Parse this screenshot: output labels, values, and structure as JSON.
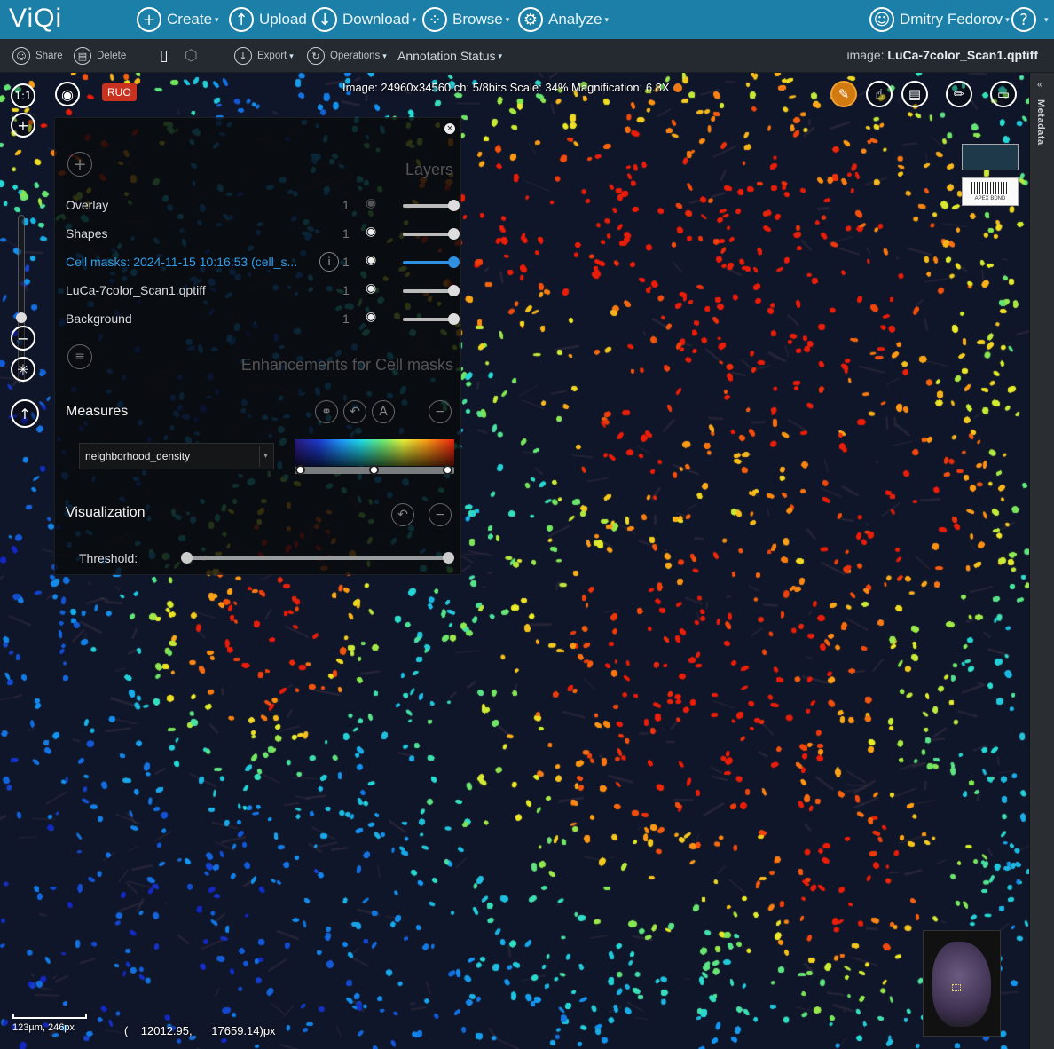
{
  "app": {
    "logo": "ViQi"
  },
  "nav": {
    "create": "Create",
    "upload": "Upload",
    "download": "Download",
    "browse": "Browse",
    "analyze": "Analyze",
    "user": "Dmitry Fedorov",
    "help_icon": "?"
  },
  "toolbar": {
    "share": "Share",
    "delete": "Delete",
    "export": "Export",
    "operations": "Operations",
    "annotation_status": "Annotation Status",
    "image_label": "image:",
    "image_name": "LuCa-7color_Scan1.qptiff"
  },
  "viewer": {
    "zoom_1to1": "1:1",
    "ruo": "RUO",
    "info": "Image: 24960x34560 ch: 5/8bits Scale: 34% Magnification: 6.8X",
    "scale_text": "123µm, 246px",
    "coords": "(    12012.95,      17659.14)px",
    "thumb_label": "APEX BDND",
    "metadata_tab": "Metadata"
  },
  "panel": {
    "layers_title": "Layers",
    "layers": [
      {
        "name": "Overlay",
        "count": "1",
        "visible": false,
        "active": false
      },
      {
        "name": "Shapes",
        "count": "1",
        "visible": true,
        "active": false
      },
      {
        "name": "Cell masks: 2024-11-15 10:16:53 (cell_s...",
        "count": "1",
        "visible": true,
        "active": true
      },
      {
        "name": "LuCa-7color_Scan1.qptiff",
        "count": "1",
        "visible": true,
        "active": false
      },
      {
        "name": "Background",
        "count": "1",
        "visible": true,
        "active": false
      }
    ],
    "enhancements_title": "Enhancements for Cell masks",
    "measures_title": "Measures",
    "measure_selected": "neighborhood_density",
    "visualization_title": "Visualization",
    "threshold_label": "Threshold:",
    "threshold_range": [
      0,
      1
    ]
  },
  "colors": {
    "nav_bg": "#1b7fa7",
    "toolbar_bg": "#252a31",
    "active_layer": "#2f9fe8",
    "ruo_badge": "#c8321f"
  }
}
